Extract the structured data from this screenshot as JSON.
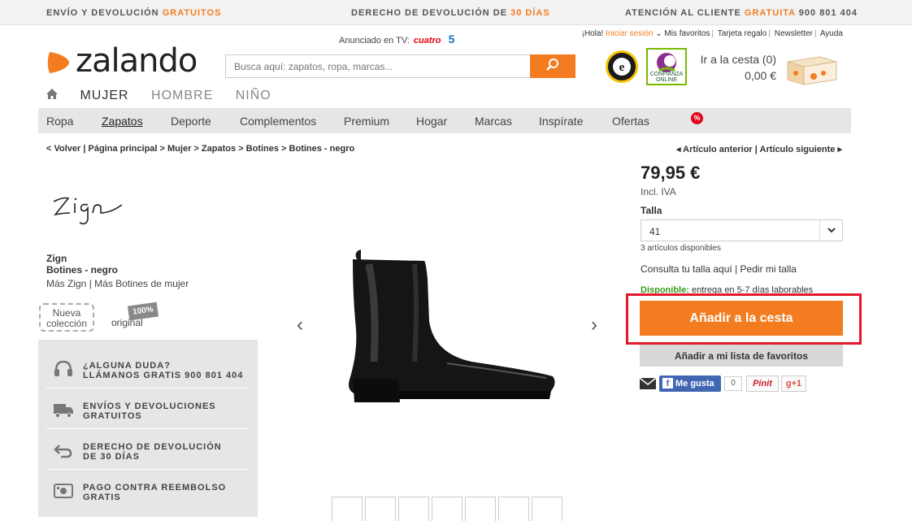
{
  "promo": {
    "left_text": "ENVÍO Y DEVOLUCIÓN",
    "left_highlight": "GRATUITOS",
    "center_text": "DERECHO DE DEVOLUCIÓN DE",
    "center_highlight": "30 DÍAS",
    "right_text": "ATENCIÓN AL CLIENTE",
    "right_highlight": "GRATUITA",
    "right_phone": "900 801 404"
  },
  "header": {
    "logo_text": "zalando",
    "tv_label": "Anunciado en TV:",
    "tv_channel": "cuatro",
    "tv_channel2": "5",
    "greeting": "¡Hola!",
    "login": "Iniciar sesión",
    "links": [
      "Mis favoritos",
      "Tarjeta regalo",
      "Newsletter",
      "Ayuda"
    ],
    "search_placeholder": "Busca aquí: zapatos, ropa, marcas...",
    "badge_confianza": "CONFIANZA ONLINE",
    "cart_label": "Ir a la cesta (0)",
    "cart_amount": "0,00 €"
  },
  "gender_tabs": [
    "MUJER",
    "HOMBRE",
    "NIÑO"
  ],
  "categories": [
    "Ropa",
    "Zapatos",
    "Deporte",
    "Complementos",
    "Premium",
    "Hogar",
    "Marcas",
    "Inspírate",
    "Ofertas"
  ],
  "offers_badge": "%",
  "breadcrumb": {
    "back": "< Volver",
    "items": [
      "Página principal",
      "Mujer",
      "Zapatos",
      "Botines",
      "Botines - negro"
    ]
  },
  "article_nav": {
    "prev": "Artículo anterior",
    "next": "Artículo siguiente"
  },
  "product": {
    "brand": "Zign",
    "name": "Botines - negro",
    "more_brand": "Más Zign",
    "more_category": "Más Botines de mujer",
    "new_badge_line1": "Nueva",
    "new_badge_line2": "colección",
    "original_badge": "100%",
    "original_label": "original",
    "price": "79,95 €",
    "vat": "Incl. IVA",
    "size_label": "Talla",
    "size_value": "41",
    "stock": "3 artículos disponibles",
    "size_link1": "Consulta tu talla aquí",
    "size_link2": "Pedir mi talla",
    "availability_label": "Disponible:",
    "availability_text": "entrega en 5-7 días laborables",
    "add_to_cart": "Añadir a la cesta",
    "add_to_wishlist": "Añadir a mi lista de favoritos"
  },
  "service": [
    {
      "line1": "¿ALGUNA DUDA?",
      "line2": "LLÁMANOS GRATIS 900 801 404",
      "icon": "headset-icon"
    },
    {
      "line1": "ENVÍOS Y DEVOLUCIONES",
      "line2": "GRATUITOS",
      "icon": "truck-icon"
    },
    {
      "line1": "DERECHO DE DEVOLUCIÓN",
      "line2": "DE 30 DÍAS",
      "icon": "return-arrow-icon"
    },
    {
      "line1": "PAGO CONTRA REEMBOLSO",
      "line2": "GRATIS",
      "icon": "cash-icon"
    }
  ],
  "social": {
    "like": "Me gusta",
    "like_count": "0",
    "pin": "Pinit",
    "gplus": "g+1"
  },
  "colors": {
    "accent": "#f47c20",
    "highlight_border": "#e3192b",
    "category_bar": "#e6e6e6"
  }
}
